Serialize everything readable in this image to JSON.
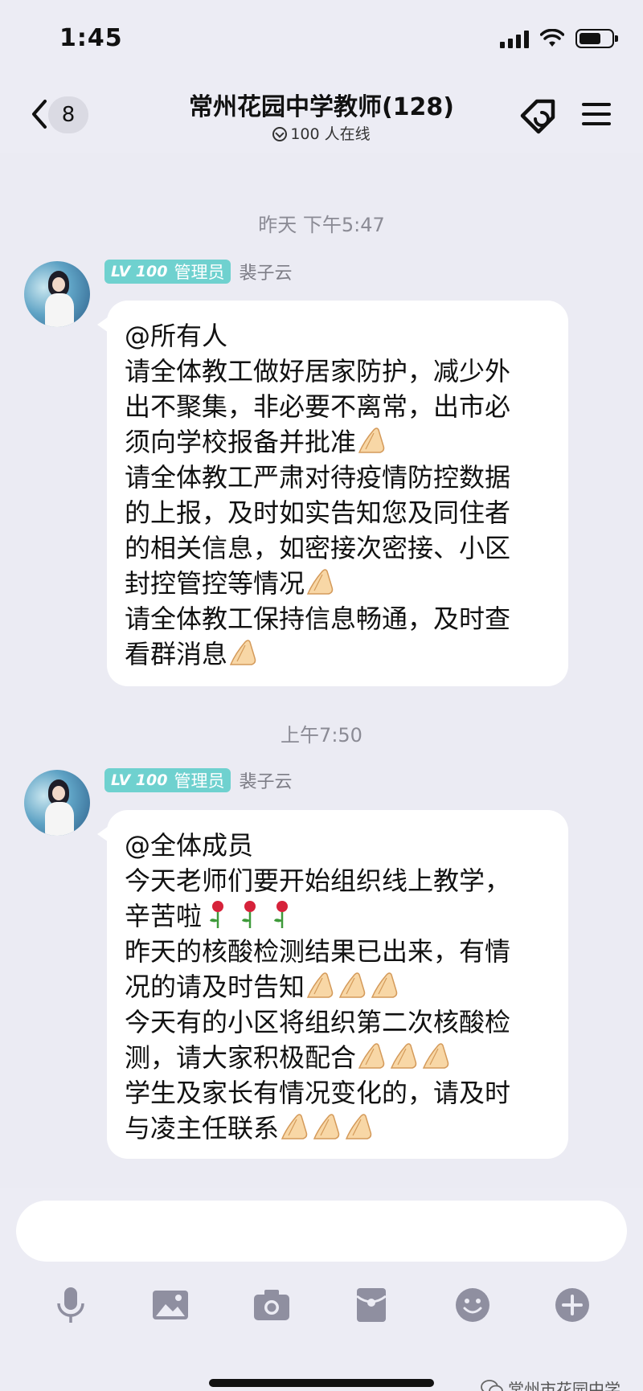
{
  "status_bar": {
    "time": "1:45"
  },
  "header": {
    "unread_count": "8",
    "title": "常州花园中学教师(128)",
    "online": "100 人在线"
  },
  "messages": [
    {
      "time": "昨天 下午5:47",
      "level": "LV 100",
      "role": "管理员",
      "sender": "裴子云",
      "lines": [
        "@所有人",
        "请全体教工做好居家防护，减少外",
        "出不聚集，非必要不离常，出市必",
        "须向学校报备并批准",
        "请全体教工严肃对待疫情防控数据",
        "的上报，及时如实告知您及同住者",
        "的相关信息，如密接次密接、小区",
        "封控管控等情况",
        "请全体教工保持信息畅通，及时查",
        "看群消息"
      ]
    },
    {
      "time": "上午7:50",
      "level": "LV 100",
      "role": "管理员",
      "sender": "裴子云",
      "lines": [
        "@全体成员",
        "今天老师们要开始组织线上教学，",
        "辛苦啦",
        "昨天的核酸检测结果已出来，有情",
        "况的请及时告知",
        "今天有的小区将组织第二次核酸检",
        "测，请大家积极配合",
        "学生及家长有情况变化的，请及时",
        "与凌主任联系"
      ]
    }
  ],
  "input": {
    "placeholder": ""
  },
  "toolbar": [
    "microphone-icon",
    "image-icon",
    "camera-icon",
    "red-packet-icon",
    "emoji-icon",
    "plus-icon"
  ],
  "watermark": "常州市花园中学",
  "colors": {
    "badge": "#6fd1cf",
    "background": "#ebebf3",
    "bubble": "#ffffff"
  },
  "emoji": {
    "folded_hands": "folded-hands-emoji",
    "rose": "rose-emoji"
  }
}
